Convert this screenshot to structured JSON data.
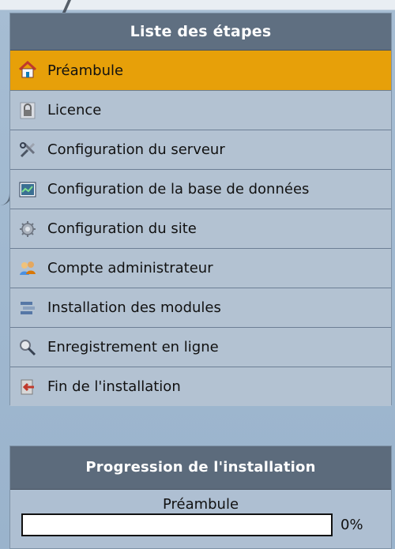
{
  "steps_panel": {
    "title": "Liste des étapes",
    "items": [
      {
        "label": "Préambule",
        "icon": "home-icon",
        "active": true
      },
      {
        "label": "Licence",
        "icon": "lock-icon",
        "active": false
      },
      {
        "label": "Configuration du serveur",
        "icon": "tools-icon",
        "active": false
      },
      {
        "label": "Configuration de la base de données",
        "icon": "database-icon",
        "active": false
      },
      {
        "label": "Configuration du site",
        "icon": "gear-icon",
        "active": false
      },
      {
        "label": "Compte administrateur",
        "icon": "users-icon",
        "active": false
      },
      {
        "label": "Installation des modules",
        "icon": "modules-icon",
        "active": false
      },
      {
        "label": "Enregistrement en ligne",
        "icon": "search-icon",
        "active": false
      },
      {
        "label": "Fin de l'installation",
        "icon": "exit-icon",
        "active": false
      }
    ]
  },
  "progress_panel": {
    "title": "Progression de l'installation",
    "current_step": "Préambule",
    "percent_label": "0%",
    "percent": 0
  },
  "colors": {
    "active": "#e7a009",
    "header": "#5f6f81",
    "row": "#b3c2d2",
    "background": "#9ab3cc"
  }
}
